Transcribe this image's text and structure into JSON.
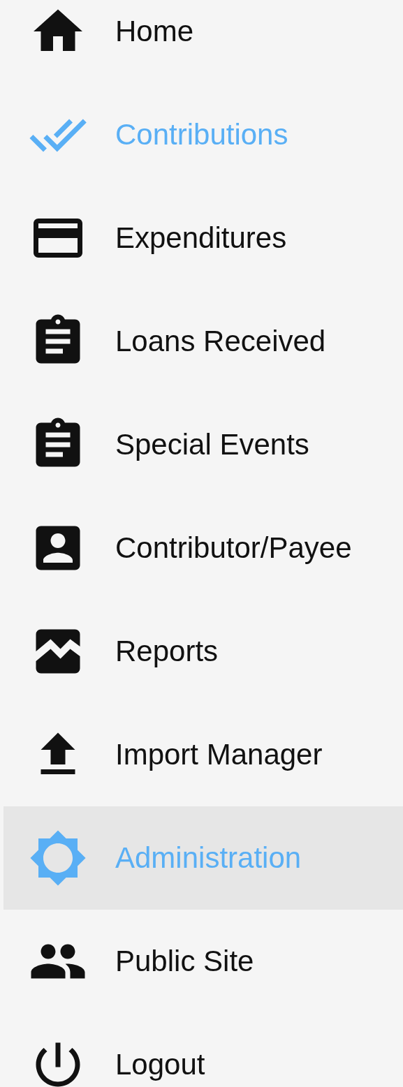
{
  "nav": {
    "items": [
      {
        "label": "Home",
        "selected": false,
        "hovered": false
      },
      {
        "label": "Contributions",
        "selected": true,
        "hovered": false
      },
      {
        "label": "Expenditures",
        "selected": false,
        "hovered": false
      },
      {
        "label": "Loans Received",
        "selected": false,
        "hovered": false
      },
      {
        "label": "Special Events",
        "selected": false,
        "hovered": false
      },
      {
        "label": "Contributor/Payee",
        "selected": false,
        "hovered": false
      },
      {
        "label": "Reports",
        "selected": false,
        "hovered": false
      },
      {
        "label": "Import Manager",
        "selected": false,
        "hovered": false
      },
      {
        "label": "Administration",
        "selected": true,
        "hovered": true
      },
      {
        "label": "Public Site",
        "selected": false,
        "hovered": false
      },
      {
        "label": "Logout",
        "selected": false,
        "hovered": false
      }
    ]
  }
}
